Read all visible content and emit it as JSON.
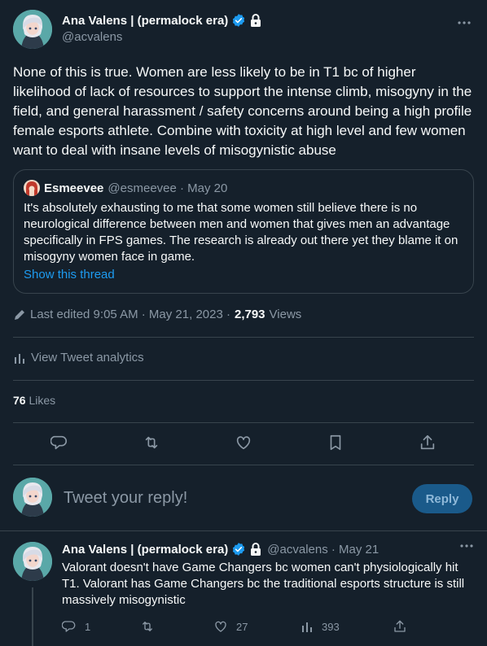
{
  "main_tweet": {
    "author_name": "Ana Valens | (permalock era)",
    "handle": "@acvalens",
    "text": "None of this is true. Women are less likely to be in T1 bc of higher likelihood of lack of resources to support the intense climb, misogyny in the field, and general harassment / safety concerns around being a high profile female esports athlete. Combine with toxicity at high level and few women want to deal with insane levels of misogynistic abuse",
    "edited_label": "Last edited 9:05 AM · May 21, 2023 ·",
    "views_count": "2,793",
    "views_label": "Views",
    "analytics_label": "View Tweet analytics",
    "likes_count": "76",
    "likes_label": "Likes"
  },
  "quoted_tweet": {
    "author_name": "Esmeevee",
    "meta": "@esmeevee · May 20",
    "text": "It's absolutely exhausting to me that some women still believe there is no neurological difference between men and women that gives men an advantage specifically in FPS games. The research is already out there yet they blame it on misogyny women face in game.",
    "link_label": "Show this thread"
  },
  "reply_box": {
    "placeholder": "Tweet your reply!",
    "button_label": "Reply"
  },
  "thread_reply": {
    "author_name": "Ana Valens | (permalock era)",
    "meta": "@acvalens · May 21",
    "text": "Valorant doesn't have Game Changers bc women can't physiologically hit T1. Valorant has Game Changers bc the traditional esports structure is still massively misogynistic",
    "reply_count": "1",
    "like_count": "27",
    "view_count": "393"
  },
  "icons": {
    "verified": "verified-badge-icon",
    "lock": "lock-icon",
    "more": "more-icon",
    "reply": "reply-icon",
    "retweet": "retweet-icon",
    "like": "heart-icon",
    "bookmark": "bookmark-icon",
    "share": "share-icon",
    "analytics": "analytics-icon",
    "edit": "pencil-icon"
  },
  "colors": {
    "background": "#15202b",
    "accent": "#1d9bf0",
    "muted_text": "#8b98a5",
    "border": "#38444d"
  }
}
